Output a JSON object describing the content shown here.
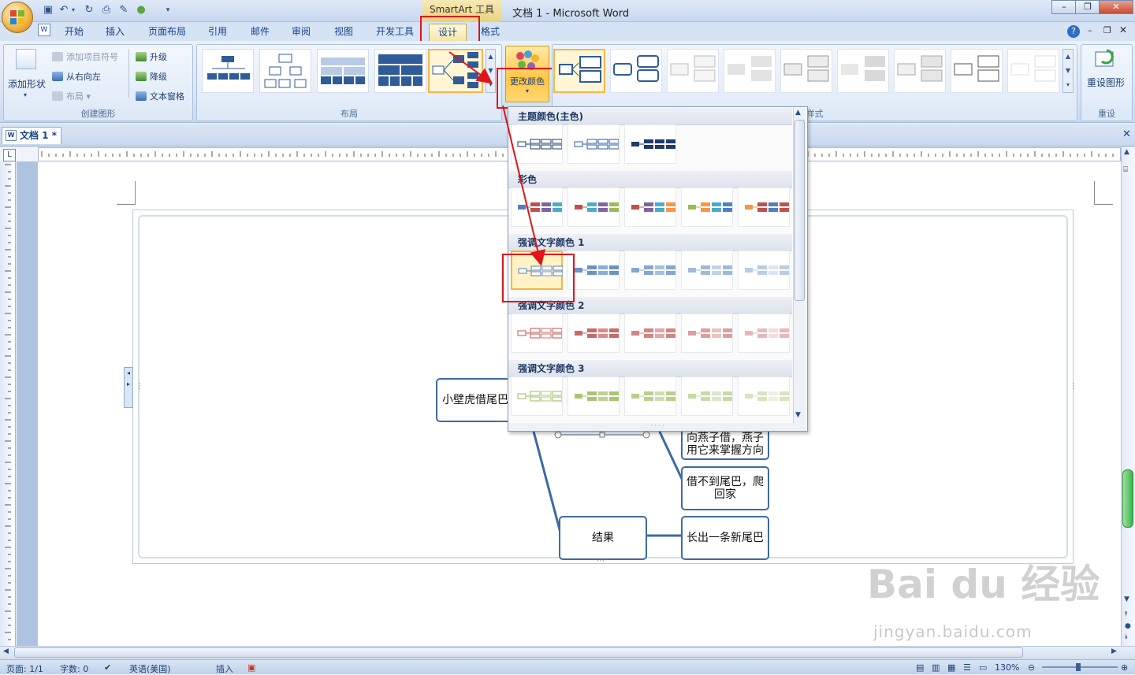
{
  "window": {
    "tool_context": "SmartArt 工具",
    "title": "文档 1 - Microsoft Word",
    "controls": [
      "–",
      "❐",
      "✕"
    ]
  },
  "tabs": [
    "开始",
    "插入",
    "页面布局",
    "引用",
    "邮件",
    "审阅",
    "视图",
    "开发工具",
    "设计",
    "格式"
  ],
  "active_tab": "设计",
  "ribbon": {
    "create_group": {
      "label": "创建图形",
      "add_shape": "添加形状",
      "add_bullet": "添加项目符号",
      "right_to_left": "从右向左",
      "layout": "布局",
      "promote": "升级",
      "demote": "降级",
      "text_pane": "文本窗格"
    },
    "layout_group": {
      "label": "布局"
    },
    "change_colors": "更改颜色",
    "styles_group": {
      "label": "样式"
    },
    "reset_group": {
      "label": "重设",
      "reset_graphic": "重设图形"
    }
  },
  "document": {
    "tab_name": "文档 1 *",
    "smartart_nodes": {
      "root": "小壁虎借尾巴",
      "node_a": "向燕子借，燕子用它来掌握方向",
      "node_b": "借不到尾巴，爬回家",
      "result": "结果",
      "result_child": "长出一条新尾巴"
    }
  },
  "color_dropdown": {
    "sections": [
      {
        "title": "主题颜色(主色)",
        "count": 3
      },
      {
        "title": "彩色",
        "count": 5
      },
      {
        "title": "强调文字颜色 1",
        "count": 5
      },
      {
        "title": "强调文字颜色 2",
        "count": 5
      },
      {
        "title": "强调文字颜色 3",
        "count": 5
      }
    ],
    "palette": {
      "theme": [
        "#1f3a6b",
        "#2b5aa0",
        "#1f3a6b"
      ],
      "accent1": "#4f81bd",
      "accent2": "#c0504d",
      "accent3": "#9bbb59",
      "colorful": [
        "#4f81bd",
        "#c0504d",
        "#9bbb59",
        "#8064a2",
        "#4bacc6",
        "#f79646"
      ]
    }
  },
  "statusbar": {
    "page": "页面: 1/1",
    "words": "字数: 0",
    "language": "英语(美国)",
    "mode": "插入",
    "zoom": "130%"
  },
  "watermark": {
    "brand": "Bai du 经验",
    "url": "jingyan.baidu.com"
  },
  "colors": {
    "highlight_red": "#e0141b",
    "selection_gold": "#f2b64a",
    "node_border": "#3e6aa3"
  }
}
